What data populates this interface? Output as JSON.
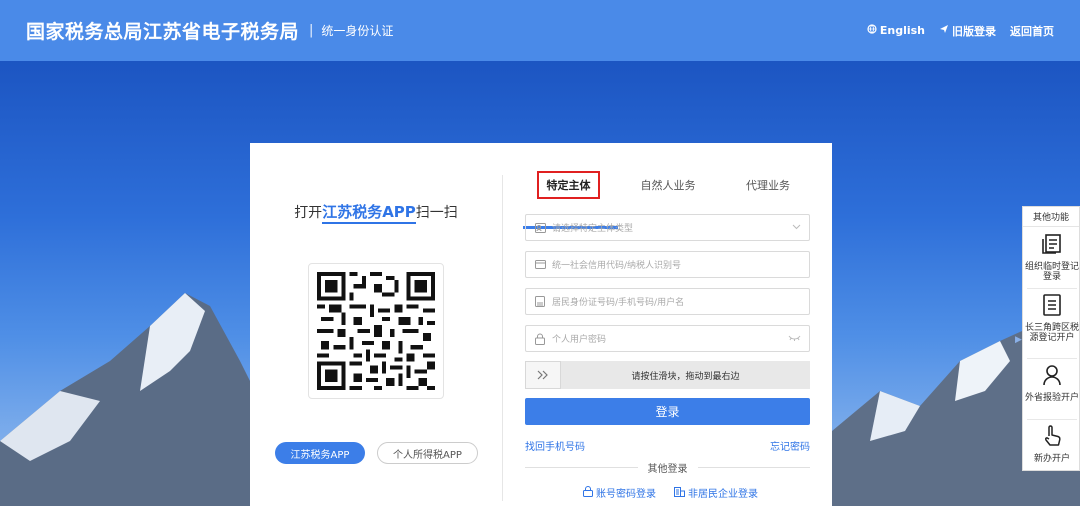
{
  "header": {
    "brand": "国家税务总局江苏省电子税务局",
    "separator": "|",
    "subtitle": "统一身份认证",
    "links": [
      {
        "icon": "globe-icon",
        "label": "English"
      },
      {
        "icon": "send-icon",
        "label": "旧版登录"
      },
      {
        "label": "返回首页"
      }
    ]
  },
  "scan": {
    "prefix": "打开",
    "app_name": "江苏税务APP",
    "suffix": "扫一扫"
  },
  "app_buttons": {
    "primary": "江苏税务APP",
    "secondary": "个人所得税APP"
  },
  "tabs": [
    {
      "label": "特定主体",
      "active": true
    },
    {
      "label": "自然人业务",
      "active": false
    },
    {
      "label": "代理业务",
      "active": false
    }
  ],
  "fields": {
    "entity_type": {
      "icon": "id-card-icon",
      "placeholder": "请选择特定主体类型",
      "tail_icon": "chevron-down-icon"
    },
    "credit_code": {
      "icon": "card-icon",
      "placeholder": "统一社会信用代码/纳税人识别号"
    },
    "username": {
      "icon": "user-id-icon",
      "placeholder": "居民身份证号码/手机号码/用户名"
    },
    "password": {
      "icon": "lock-icon",
      "placeholder": "个人用户密码",
      "tail_icon": "eye-closed-icon"
    }
  },
  "slider": {
    "handle_icon": "double-chevron-right-icon",
    "text": "请按住滑块，拖动到最右边"
  },
  "login_button": "登录",
  "links": {
    "find_phone": "找回手机号码",
    "forgot_password": "忘记密码"
  },
  "other_login": {
    "title": "其他登录",
    "options": [
      {
        "icon": "lock-icon",
        "label": "账号密码登录"
      },
      {
        "icon": "enterprise-icon",
        "label": "非居民企业登录"
      }
    ]
  },
  "side_panel": {
    "title": "其他功能",
    "items": [
      {
        "icon": "document-icon",
        "label": "组织临时登记登录"
      },
      {
        "icon": "list-icon",
        "label": "长三角跨区税源登记开户"
      },
      {
        "icon": "person-icon",
        "label": "外省报验开户"
      },
      {
        "icon": "hand-pointer-icon",
        "label": "新办开户"
      }
    ]
  },
  "colors": {
    "header_bg": "#4a8ae8",
    "accent": "#3c7ee8",
    "link": "#2f74e6",
    "highlight_box": "#e02020"
  }
}
